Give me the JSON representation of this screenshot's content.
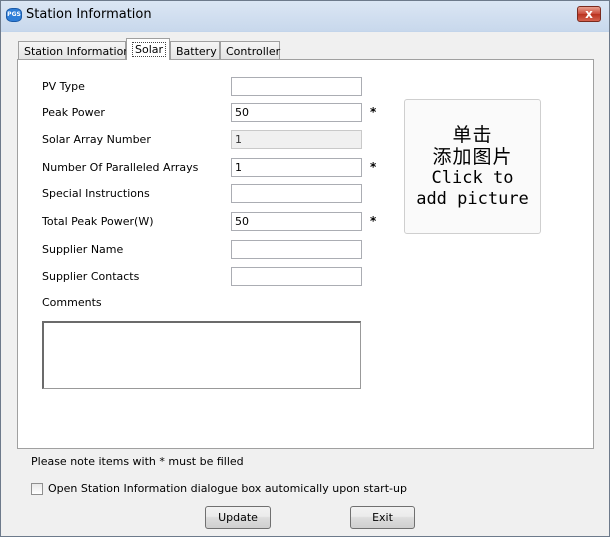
{
  "window": {
    "title": "Station Information",
    "icon_label": "PGS",
    "close_symbol": "x"
  },
  "tabs": [
    {
      "label": "Station Information",
      "active": false
    },
    {
      "label": "Solar",
      "active": true
    },
    {
      "label": "Battery",
      "active": false
    },
    {
      "label": "Controller",
      "active": false
    }
  ],
  "form": {
    "pv_type": {
      "label": "PV Type",
      "value": ""
    },
    "peak_power": {
      "label": "Peak Power",
      "value": "50",
      "required": "*"
    },
    "solar_array_number": {
      "label": "Solar Array Number",
      "value": "1"
    },
    "paralleled_arrays": {
      "label": "Number Of Paralleled Arrays",
      "value": "1",
      "required": "*"
    },
    "special_instructions": {
      "label": "Special Instructions",
      "value": ""
    },
    "total_peak_power": {
      "label": "Total Peak Power(W)",
      "value": "50",
      "required": "*"
    },
    "supplier_name": {
      "label": "Supplier Name",
      "value": ""
    },
    "supplier_contacts": {
      "label": "Supplier Contacts",
      "value": ""
    },
    "comments": {
      "label": "Comments",
      "value": ""
    }
  },
  "picture": {
    "cn_line1": "单击",
    "cn_line2": "添加图片",
    "en_line1": "Click to",
    "en_line2": "add picture"
  },
  "footer": {
    "note": "Please note items with * must be filled",
    "startup_checkbox_label": "Open Station Information dialogue box automically upon start-up",
    "update_label": "Update",
    "exit_label": "Exit"
  }
}
